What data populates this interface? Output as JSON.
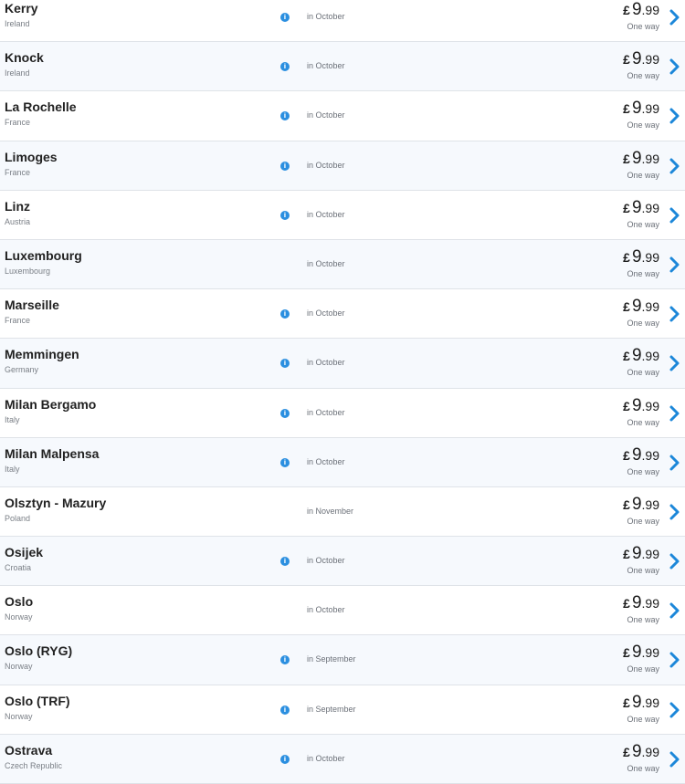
{
  "colors": {
    "accent": "#1c87d9",
    "row_alt_bg": "#f6f9fd",
    "divider": "#dfe3e8"
  },
  "icons": {
    "info": "info-icon",
    "next": "chevron-right-icon"
  },
  "rows": [
    {
      "city": "Kerry",
      "country": "Ireland",
      "info": true,
      "month": "in October",
      "currency": "£",
      "price_int": "9",
      "price_dec": ".99",
      "fare_type": "One way"
    },
    {
      "city": "Knock",
      "country": "Ireland",
      "info": true,
      "month": "in October",
      "currency": "£",
      "price_int": "9",
      "price_dec": ".99",
      "fare_type": "One way"
    },
    {
      "city": "La Rochelle",
      "country": "France",
      "info": true,
      "month": "in October",
      "currency": "£",
      "price_int": "9",
      "price_dec": ".99",
      "fare_type": "One way"
    },
    {
      "city": "Limoges",
      "country": "France",
      "info": true,
      "month": "in October",
      "currency": "£",
      "price_int": "9",
      "price_dec": ".99",
      "fare_type": "One way"
    },
    {
      "city": "Linz",
      "country": "Austria",
      "info": true,
      "month": "in October",
      "currency": "£",
      "price_int": "9",
      "price_dec": ".99",
      "fare_type": "One way"
    },
    {
      "city": "Luxembourg",
      "country": "Luxembourg",
      "info": false,
      "month": "in October",
      "currency": "£",
      "price_int": "9",
      "price_dec": ".99",
      "fare_type": "One way"
    },
    {
      "city": "Marseille",
      "country": "France",
      "info": true,
      "month": "in October",
      "currency": "£",
      "price_int": "9",
      "price_dec": ".99",
      "fare_type": "One way"
    },
    {
      "city": "Memmingen",
      "country": "Germany",
      "info": true,
      "month": "in October",
      "currency": "£",
      "price_int": "9",
      "price_dec": ".99",
      "fare_type": "One way"
    },
    {
      "city": "Milan Bergamo",
      "country": "Italy",
      "info": true,
      "month": "in October",
      "currency": "£",
      "price_int": "9",
      "price_dec": ".99",
      "fare_type": "One way"
    },
    {
      "city": "Milan Malpensa",
      "country": "Italy",
      "info": true,
      "month": "in October",
      "currency": "£",
      "price_int": "9",
      "price_dec": ".99",
      "fare_type": "One way"
    },
    {
      "city": "Olsztyn - Mazury",
      "country": "Poland",
      "info": false,
      "month": "in November",
      "currency": "£",
      "price_int": "9",
      "price_dec": ".99",
      "fare_type": "One way"
    },
    {
      "city": "Osijek",
      "country": "Croatia",
      "info": true,
      "month": "in October",
      "currency": "£",
      "price_int": "9",
      "price_dec": ".99",
      "fare_type": "One way"
    },
    {
      "city": "Oslo",
      "country": "Norway",
      "info": false,
      "month": "in October",
      "currency": "£",
      "price_int": "9",
      "price_dec": ".99",
      "fare_type": "One way"
    },
    {
      "city": "Oslo (RYG)",
      "country": "Norway",
      "info": true,
      "month": "in September",
      "currency": "£",
      "price_int": "9",
      "price_dec": ".99",
      "fare_type": "One way"
    },
    {
      "city": "Oslo (TRF)",
      "country": "Norway",
      "info": true,
      "month": "in September",
      "currency": "£",
      "price_int": "9",
      "price_dec": ".99",
      "fare_type": "One way"
    },
    {
      "city": "Ostrava",
      "country": "Czech Republic",
      "info": true,
      "month": "in October",
      "currency": "£",
      "price_int": "9",
      "price_dec": ".99",
      "fare_type": "One way"
    }
  ]
}
